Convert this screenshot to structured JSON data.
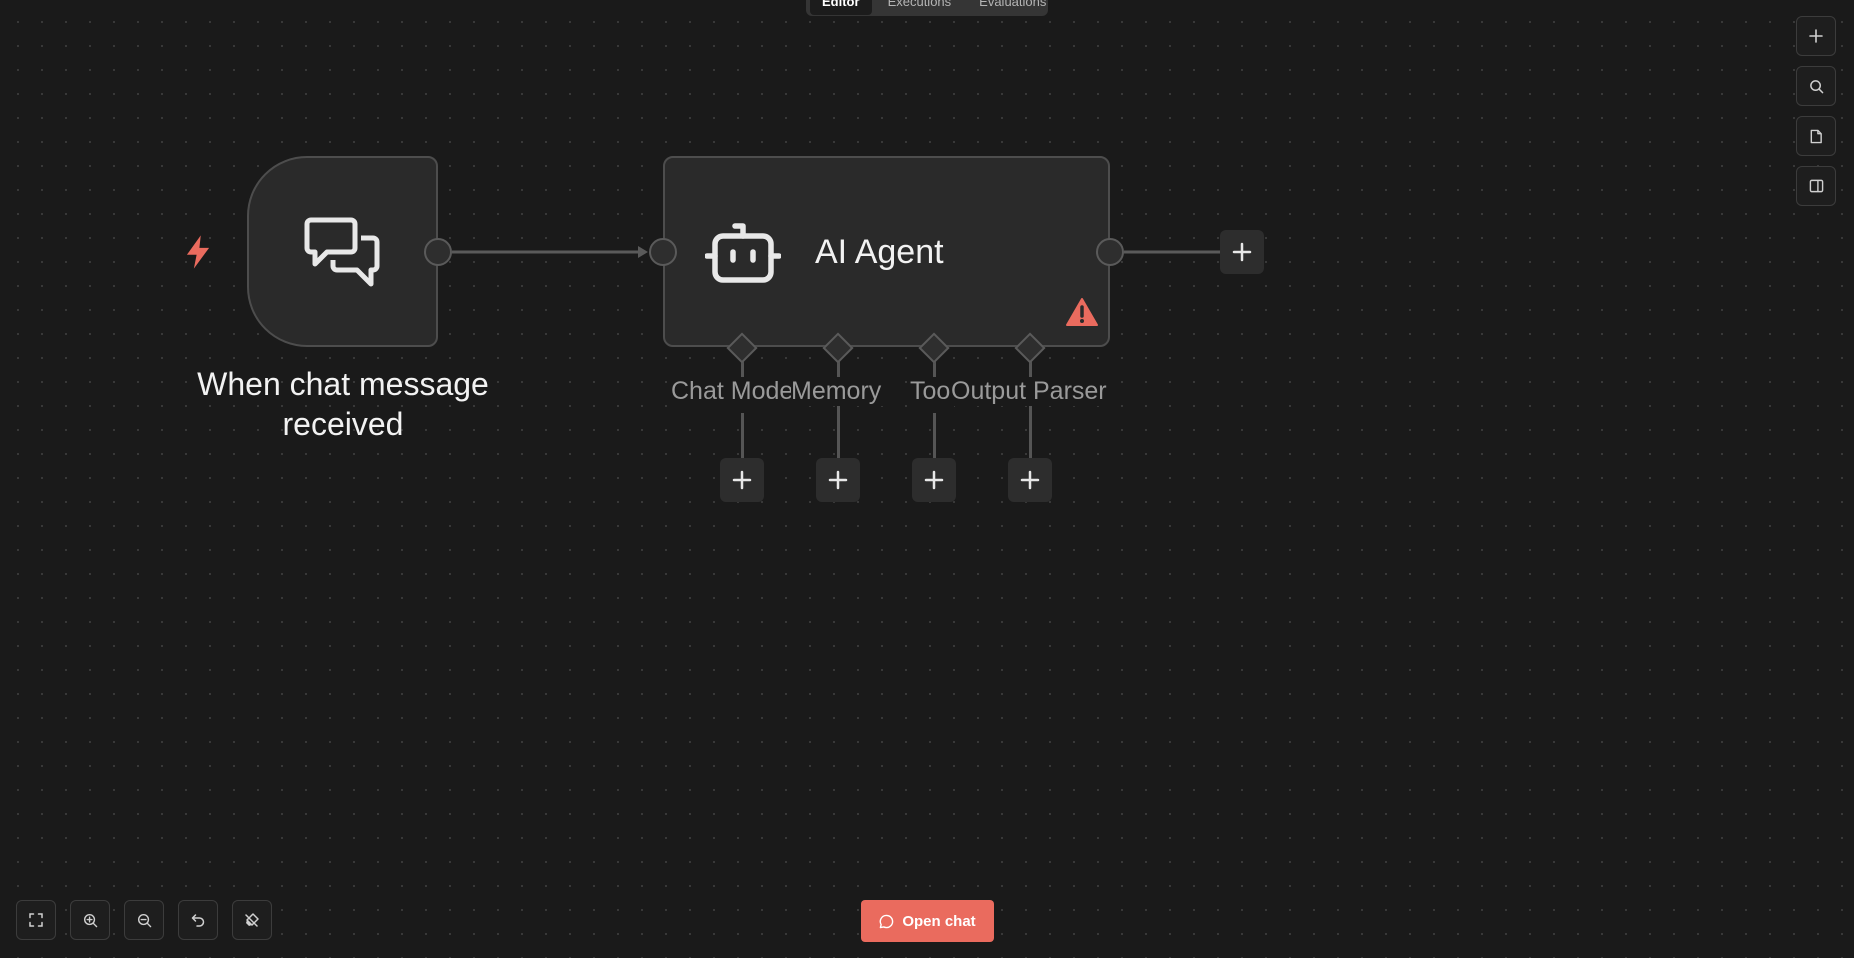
{
  "tabs": [
    {
      "label": "Editor",
      "active": true
    },
    {
      "label": "Executions",
      "active": false
    },
    {
      "label": "Evaluations",
      "active": false
    }
  ],
  "right_toolbar": [
    {
      "icon": "plus-icon"
    },
    {
      "icon": "search-icon"
    },
    {
      "icon": "sticky-note-icon"
    },
    {
      "icon": "panel-toggle-icon"
    }
  ],
  "trigger": {
    "label": "When chat message received",
    "icon": "chat-bubbles-icon",
    "badge_icon": "lightning-icon",
    "badge_color": "#ea6b5e"
  },
  "agent": {
    "title": "AI Agent",
    "icon": "robot-icon",
    "warning_icon": "warning-triangle-icon",
    "warning_color": "#ea6b5e",
    "sub_connectors": [
      {
        "label": "Chat Model"
      },
      {
        "label": "Memory"
      },
      {
        "label": "Tool"
      },
      {
        "label": "Output Parser"
      }
    ]
  },
  "bottom_toolbar": [
    {
      "icon": "fit-view-icon"
    },
    {
      "icon": "zoom-in-icon"
    },
    {
      "icon": "zoom-out-icon"
    },
    {
      "icon": "undo-icon"
    },
    {
      "icon": "tidy-up-icon"
    }
  ],
  "open_chat": {
    "label": "Open chat",
    "color": "#ea6b5e"
  }
}
